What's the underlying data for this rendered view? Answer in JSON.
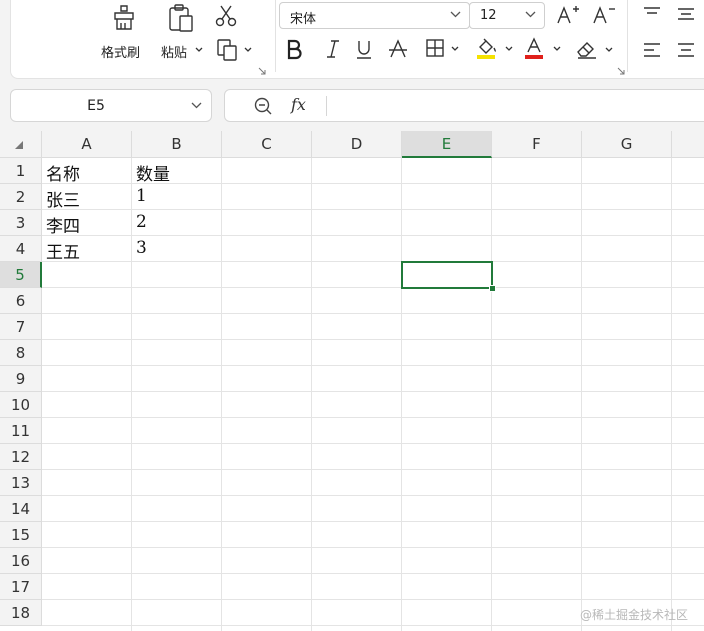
{
  "ribbon": {
    "clipboard": {
      "format_painter_label": "格式刷",
      "paste_label": "粘贴"
    },
    "font": {
      "font_name": "宋体",
      "font_size": "12"
    }
  },
  "formula_bar": {
    "name_box": "E5",
    "fx_label": "fx",
    "formula": ""
  },
  "grid": {
    "columns": [
      "A",
      "B",
      "C",
      "D",
      "E",
      "F",
      "G"
    ],
    "rows": [
      "1",
      "2",
      "3",
      "4",
      "5",
      "6",
      "7",
      "8",
      "9",
      "10",
      "11",
      "12",
      "13",
      "14",
      "15",
      "16",
      "17",
      "18"
    ],
    "selected_column": "E",
    "selected_row": "5",
    "cells": {
      "A1": "名称",
      "B1": "数量",
      "A2": "张三",
      "B2": "1",
      "A3": "李四",
      "B3": "2",
      "A4": "王五",
      "B4": "3"
    }
  },
  "colors": {
    "accent": "#217a3a",
    "highlight_yellow": "#f5e200",
    "font_red": "#e0201b"
  },
  "watermark": "@稀土掘金技术社区"
}
